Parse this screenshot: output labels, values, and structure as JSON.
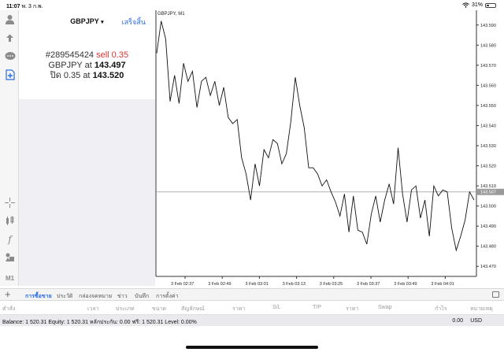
{
  "status": {
    "time": "11:07",
    "date": "พ. 3 ก.พ.",
    "battery": "31%",
    "battery_level": 0.31
  },
  "toolbar": {
    "icons": [
      "account-icon",
      "trade-icon",
      "chat-icon",
      "new-order-icon",
      "crosshair-icon",
      "indicators-icon",
      "function-icon",
      "objects-icon",
      "timeframe-label"
    ],
    "timeframe": "M1"
  },
  "order_panel": {
    "symbol": "GBPJPY",
    "symbol_arrow": "▾",
    "done_label": "เสร็จสิ้น",
    "order_number": "#289545424",
    "order_type": "sell 0.35",
    "line2_symbol": "GBPJPY at",
    "line2_price": "143.497",
    "line3_text": "ปิด 0.35 at",
    "line3_price": "143.520"
  },
  "chart_data": {
    "type": "line",
    "title": "GBPJPY, M1",
    "price_axis": [
      "143.590",
      "143.580",
      "143.570",
      "143.560",
      "143.550",
      "143.540",
      "143.530",
      "143.520",
      "143.510",
      "143.500",
      "143.490",
      "143.480",
      "143.470"
    ],
    "time_axis": [
      "3 Feb 02:37",
      "3 Feb 02:49",
      "3 Feb 03:01",
      "3 Feb 03:13",
      "3 Feb 03:25",
      "3 Feb 03:37",
      "3 Feb 03:49",
      "3 Feb 04:01"
    ],
    "current_price_label": "143.507",
    "current_price": 143.507,
    "ylim": [
      143.465,
      143.595
    ],
    "grid": false,
    "values": [
      143.576,
      143.592,
      143.583,
      143.552,
      143.565,
      143.551,
      143.571,
      143.562,
      143.567,
      143.549,
      143.562,
      143.564,
      143.555,
      143.562,
      143.55,
      143.559,
      143.544,
      143.541,
      143.543,
      143.524,
      143.516,
      143.503,
      143.521,
      143.51,
      143.528,
      143.524,
      143.533,
      143.531,
      143.521,
      143.526,
      143.542,
      143.564,
      143.55,
      143.539,
      143.519,
      143.519,
      143.516,
      143.51,
      143.513,
      143.507,
      143.502,
      143.495,
      143.506,
      143.487,
      143.505,
      143.488,
      143.487,
      143.481,
      143.496,
      143.505,
      143.492,
      143.503,
      143.511,
      143.501,
      143.529,
      143.506,
      143.492,
      143.508,
      143.51,
      143.494,
      143.503,
      143.485,
      143.51,
      143.505,
      143.508,
      143.507,
      143.489,
      143.478,
      143.485,
      143.493,
      143.507,
      143.503
    ]
  },
  "tabs": [
    {
      "label": "การซื้อขาย",
      "active": true
    },
    {
      "label": "ประวัติ",
      "active": false
    },
    {
      "label": "กล่องจดหมาย",
      "active": false
    },
    {
      "label": "ข่าว",
      "active": false
    },
    {
      "label": "บันทึก",
      "active": false
    },
    {
      "label": "การตั้งค่า",
      "active": false
    }
  ],
  "columns": [
    "คำสั่ง",
    "เวลา",
    "ประเภท",
    "ขนาด",
    "สัญลักษณ์",
    "ราคา",
    "S/L",
    "T/P",
    "ราคา",
    "Swap",
    "กำไร",
    "หมายเหตุ"
  ],
  "balance": {
    "text": "Balance: 1 520.31 Equity: 1 520.31 หลักประกัน: 0.00 ฟรี: 1 520.31 Level: 0.00%",
    "profit": "0.00",
    "currency": "USD"
  }
}
